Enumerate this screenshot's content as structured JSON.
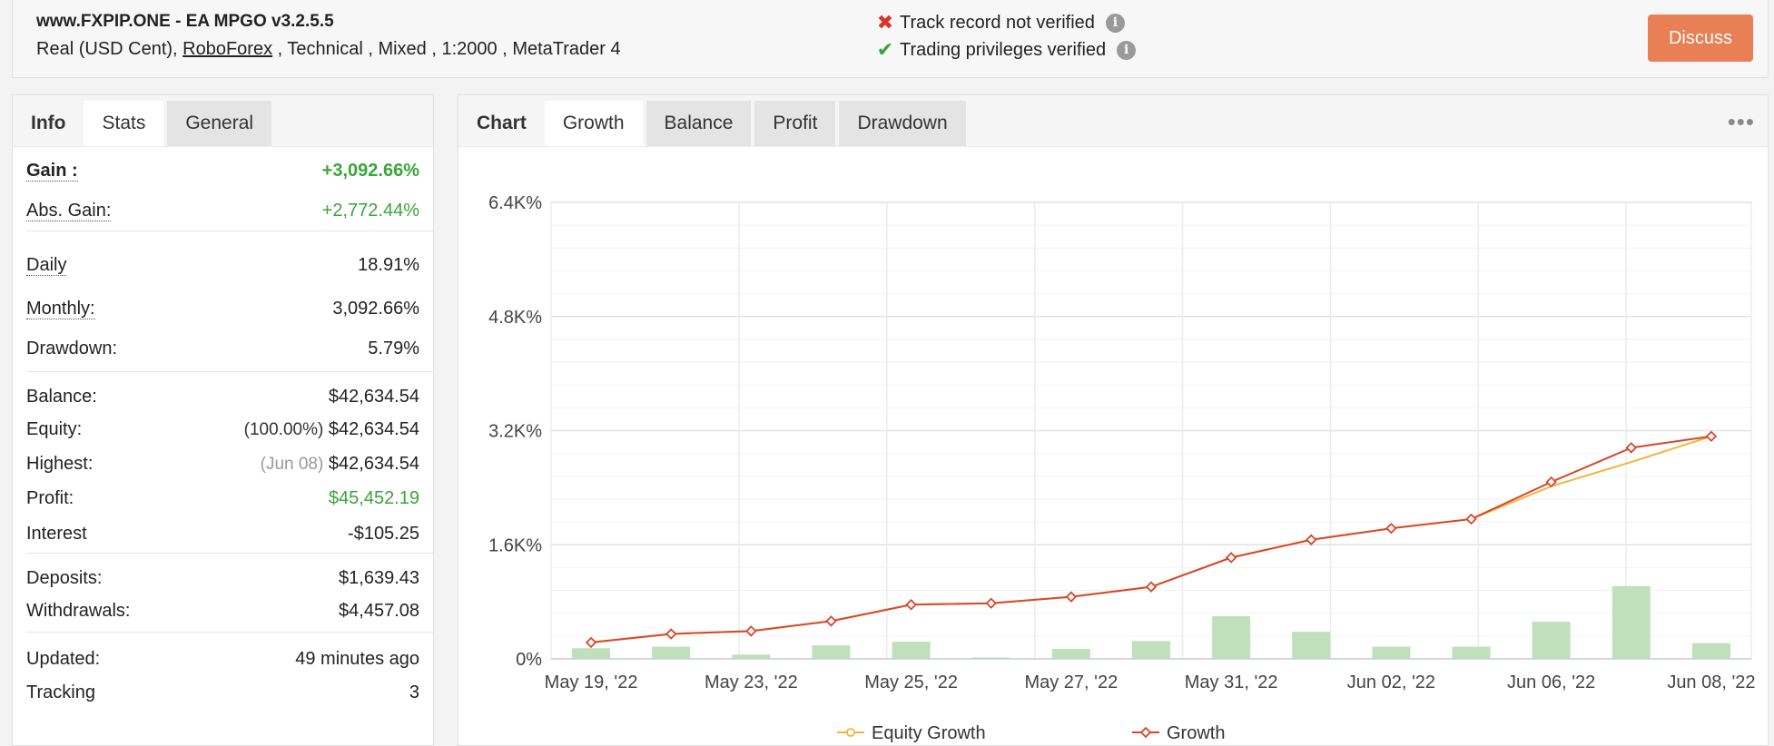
{
  "header": {
    "title": "www.FXPIP.ONE - EA MPGO v3.2.5.5",
    "account_type": "Real (USD Cent), ",
    "broker": "RoboForex",
    "details": " , Technical , Mixed , 1:2000 , MetaTrader 4",
    "track_record": "Track record not verified",
    "trading_privileges": "Trading privileges verified",
    "discuss_label": "Discuss"
  },
  "left_tabs": {
    "label": "Info",
    "tabs": [
      "Stats",
      "General"
    ]
  },
  "stats": {
    "gain": {
      "label": "Gain :",
      "value": "+3,092.66%"
    },
    "abs_gain": {
      "label": "Abs. Gain:",
      "value": "+2,772.44%"
    },
    "daily": {
      "label": "Daily",
      "value": "18.91%"
    },
    "monthly": {
      "label": "Monthly:",
      "value": "3,092.66%"
    },
    "drawdown": {
      "label": "Drawdown:",
      "value": "5.79%"
    },
    "balance": {
      "label": "Balance:",
      "value": "$42,634.54"
    },
    "equity": {
      "label": "Equity:",
      "pct": "(100.00%)",
      "value": "$42,634.54"
    },
    "highest": {
      "label": "Highest:",
      "date": "(Jun 08)",
      "value": "$42,634.54"
    },
    "profit": {
      "label": "Profit:",
      "value": "$45,452.19"
    },
    "interest": {
      "label": "Interest",
      "value": "-$105.25"
    },
    "deposits": {
      "label": "Deposits:",
      "value": "$1,639.43"
    },
    "withdrawals": {
      "label": "Withdrawals:",
      "value": "$4,457.08"
    },
    "updated": {
      "label": "Updated:",
      "value": "49 minutes ago"
    },
    "tracking": {
      "label": "Tracking",
      "value": "3"
    }
  },
  "chart_tabs": {
    "label": "Chart",
    "tabs": [
      "Growth",
      "Balance",
      "Profit",
      "Drawdown"
    ],
    "active": "Growth"
  },
  "colors": {
    "growth": "#d9472b",
    "equity": "#f0b63c",
    "bars": "#bfe0bb",
    "green": "#3aa53a",
    "accent": "#e87f55"
  },
  "chart_data": {
    "type": "line",
    "ylim": [
      0,
      6400
    ],
    "yticks": [
      "6.4K%",
      "4.8K%",
      "3.2K%",
      "1.6K%",
      "0%"
    ],
    "xtick_labels": [
      "May 19, '22",
      "May 23, '22",
      "May 25, '22",
      "May 27, '22",
      "May 31, '22",
      "Jun 02, '22",
      "Jun 06, '22",
      "Jun 08, '22"
    ],
    "grid": true,
    "legend_position": "bottom",
    "series": [
      {
        "name": "Equity Growth",
        "values": [
          230,
          350,
          390,
          530,
          760,
          780,
          870,
          1010,
          1420,
          1670,
          1830,
          1960,
          2420,
          2760,
          3120
        ]
      },
      {
        "name": "Growth",
        "values": [
          230,
          350,
          390,
          530,
          760,
          780,
          870,
          1010,
          1420,
          1670,
          1830,
          1960,
          2480,
          2960,
          3120
        ]
      }
    ],
    "bars": [
      150,
      170,
      60,
      190,
      240,
      20,
      140,
      250,
      600,
      380,
      170,
      170,
      520,
      1020,
      220
    ]
  }
}
